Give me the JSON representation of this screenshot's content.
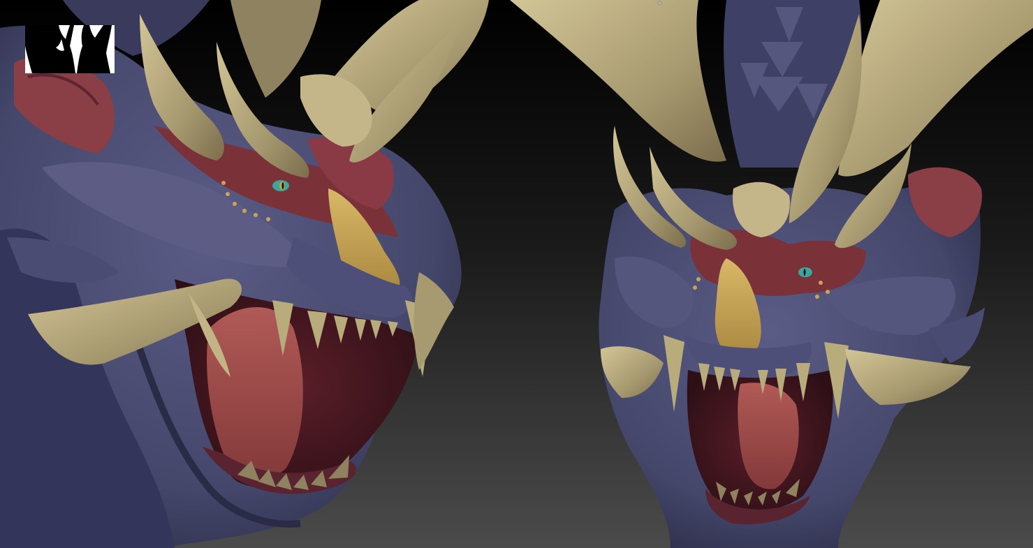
{
  "canvas": {
    "background_top": "#000000",
    "background_bottom": "#4b4b4b"
  },
  "navigator": {
    "background": "#ffffff",
    "silhouette_color": "#000000"
  },
  "palette": {
    "skin_blue": "#4a4c72",
    "skin_blue_dark": "#2e2f4c",
    "skin_purple": "#5b4a6e",
    "flesh_red": "#7a3238",
    "flesh_red_dark": "#4e1c24",
    "tongue": "#9a4a48",
    "bone": "#a89a70",
    "bone_light": "#c9bb8e",
    "bone_dark": "#7c6e4c",
    "snout_yellow": "#c9a456",
    "eye_teal": "#3aa6a0"
  }
}
